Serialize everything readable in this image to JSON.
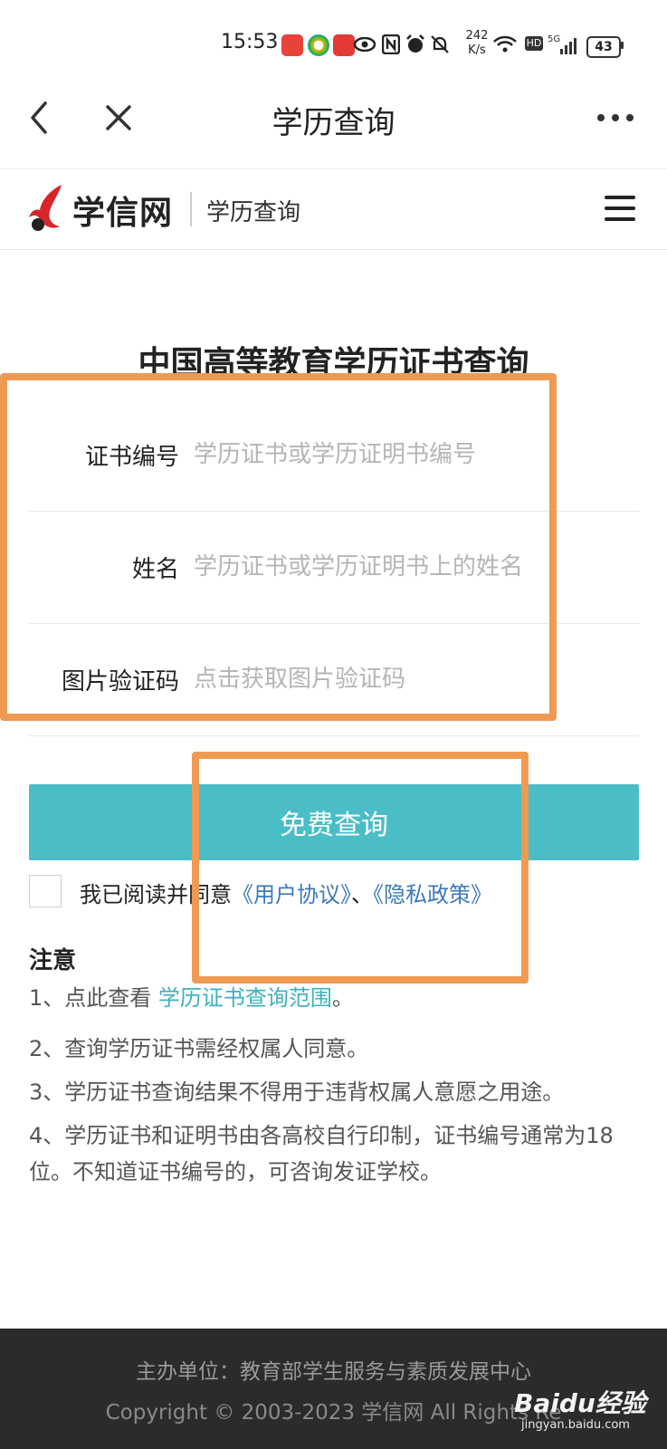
{
  "status_bar": {
    "time": "15:53",
    "network_speed_value": "242",
    "network_speed_unit": "K/s",
    "hd_label": "HD",
    "signal_label": "5G",
    "battery": "43"
  },
  "title_bar": {
    "title": "学历查询"
  },
  "site_header": {
    "logo_text": "学信网",
    "subtitle": "学历查询"
  },
  "form": {
    "heading": "中国高等教育学历证书查询",
    "fields": [
      {
        "label": "证书编号",
        "placeholder": "学历证书或学历证明书编号"
      },
      {
        "label": "姓名",
        "placeholder": "学历证书或学历证明书上的姓名"
      },
      {
        "label": "图片验证码",
        "placeholder": "点击获取图片验证码"
      }
    ],
    "submit_label": "免费查询",
    "agreement": {
      "prefix": "我已阅读并同意",
      "user_agreement": "《用户协议》",
      "separator": "、",
      "privacy_policy": "《隐私政策》"
    }
  },
  "notes": {
    "title": "注意",
    "item1_prefix": "1、点此查看 ",
    "item1_link": "学历证书查询范围",
    "item1_suffix": "。",
    "item2": "2、查询学历证书需经权属人同意。",
    "item3": "3、学历证书查询结果不得用于违背权属人意愿之用途。",
    "item4": "4、学历证书和证明书由各高校自行印制，证书编号通常为18位。不知道证书编号的，可咨询发证学校。"
  },
  "footer": {
    "sponsor": "主办单位：教育部学生服务与素质发展中心",
    "copyright": "Copyright © 2003-2023 学信网 All Rights Re"
  },
  "watermark": {
    "brand": "Baidu经验",
    "url": "jingyan.baidu.com"
  },
  "colors": {
    "accent": "#4bbdc7",
    "link": "#3c7ab8",
    "annotation": "#ef9a52",
    "footer_bg": "#2b2b2b"
  }
}
